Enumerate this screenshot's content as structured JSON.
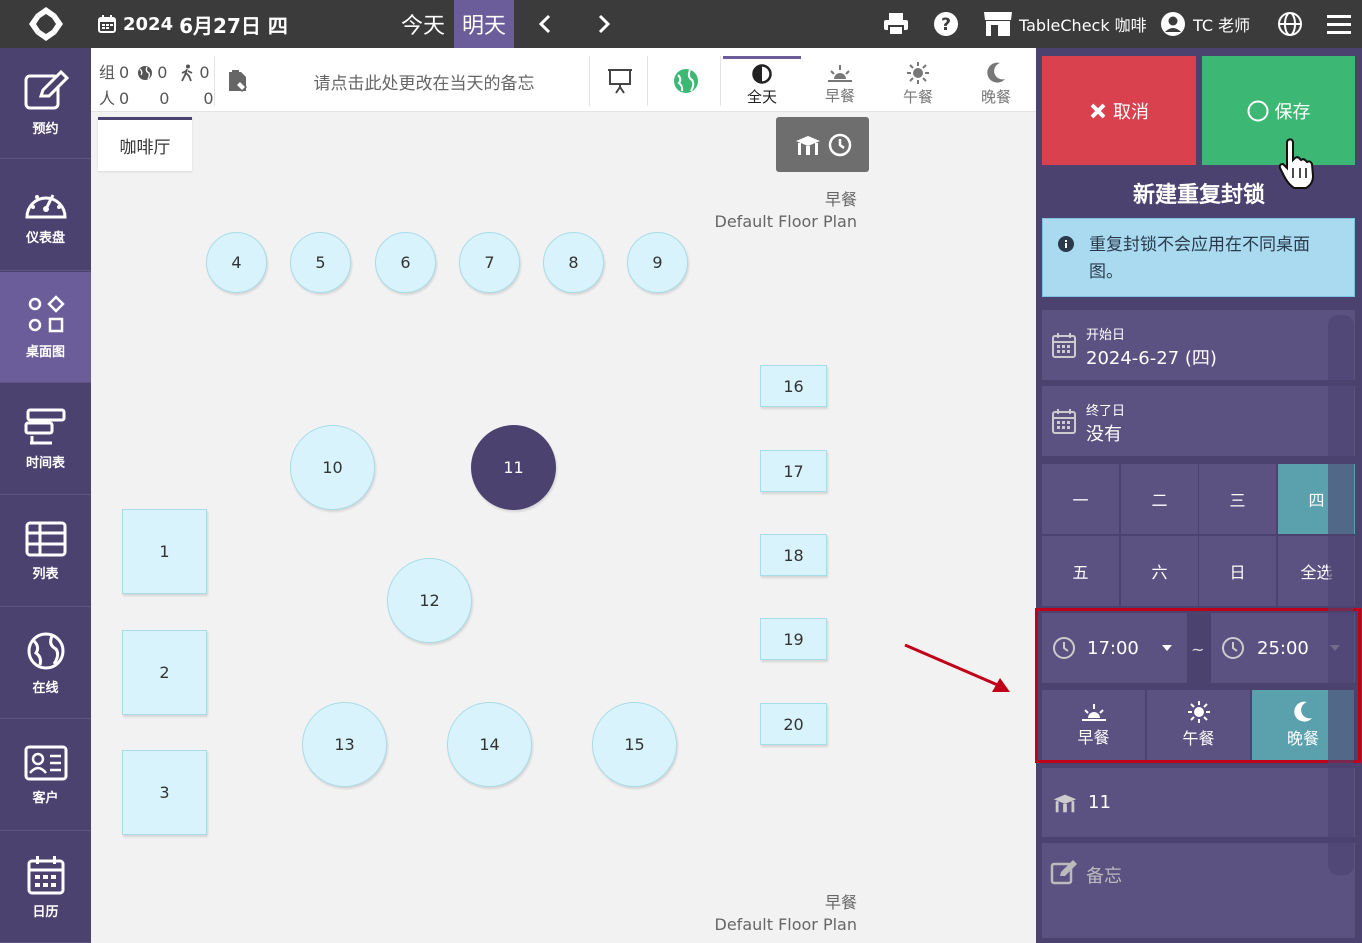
{
  "header": {
    "year": "2024",
    "date_label": "6月27日 四",
    "today_label": "今天",
    "tomorrow_label": "明天",
    "store_name": "TableCheck 咖啡",
    "user_name": "TC 老师"
  },
  "sidebar": {
    "items": [
      {
        "label": "预约",
        "icon": "edit-icon"
      },
      {
        "label": "仪表盘",
        "icon": "dashboard-icon"
      },
      {
        "label": "桌面图",
        "icon": "floorplan-icon"
      },
      {
        "label": "时间表",
        "icon": "timeline-icon"
      },
      {
        "label": "列表",
        "icon": "table-list-icon"
      },
      {
        "label": "在线",
        "icon": "globe-icon"
      },
      {
        "label": "客户",
        "icon": "customer-card-icon"
      },
      {
        "label": "日历",
        "icon": "calendar-icon"
      }
    ]
  },
  "subbar": {
    "stats": {
      "groups_label": "组",
      "groups_value": "0",
      "online_groups": "0",
      "walkin_groups": "0",
      "people_label": "人",
      "people_value": "0",
      "online_people": "0",
      "walkin_people": "0"
    },
    "memo_placeholder": "请点击此处更改在当天的备忘",
    "meal_tabs": [
      {
        "label": "全天",
        "icon": "half-circle-icon",
        "active": true
      },
      {
        "label": "早餐",
        "icon": "sunrise-icon",
        "active": false
      },
      {
        "label": "午餐",
        "icon": "sun-icon",
        "active": false
      },
      {
        "label": "晚餐",
        "icon": "moon-icon",
        "active": false
      }
    ]
  },
  "floor": {
    "tab_label": "咖啡厅",
    "plan_service": "早餐",
    "plan_name": "Default Floor Plan",
    "tables": [
      {
        "label": "4",
        "shape": "round"
      },
      {
        "label": "5",
        "shape": "round"
      },
      {
        "label": "6",
        "shape": "round"
      },
      {
        "label": "7",
        "shape": "round"
      },
      {
        "label": "8",
        "shape": "round"
      },
      {
        "label": "9",
        "shape": "round"
      },
      {
        "label": "16",
        "shape": "square"
      },
      {
        "label": "17",
        "shape": "square"
      },
      {
        "label": "18",
        "shape": "square"
      },
      {
        "label": "19",
        "shape": "square"
      },
      {
        "label": "20",
        "shape": "square"
      },
      {
        "label": "10",
        "shape": "round"
      },
      {
        "label": "11",
        "shape": "round",
        "selected": true
      },
      {
        "label": "12",
        "shape": "round"
      },
      {
        "label": "1",
        "shape": "square"
      },
      {
        "label": "2",
        "shape": "square"
      },
      {
        "label": "3",
        "shape": "square"
      },
      {
        "label": "13",
        "shape": "round"
      },
      {
        "label": "14",
        "shape": "round"
      },
      {
        "label": "15",
        "shape": "round"
      }
    ]
  },
  "panel": {
    "cancel_label": "取消",
    "save_label": "保存",
    "title": "新建重复封锁",
    "info": "重复封锁不会应用在不同桌面图。",
    "start_label": "开始日",
    "start_value": "2024-6-27 (四)",
    "end_label": "终了日",
    "end_value": "没有",
    "weekdays": [
      "一",
      "二",
      "三",
      "四",
      "五",
      "六",
      "日",
      "全选"
    ],
    "weekday_selected": "四",
    "time_from": "17:00",
    "time_sep": "~",
    "time_to": "25:00",
    "meals": [
      {
        "label": "早餐",
        "active": false
      },
      {
        "label": "午餐",
        "active": false
      },
      {
        "label": "晚餐",
        "active": true
      }
    ],
    "table_value": "11",
    "note_placeholder": "备忘"
  },
  "colors": {
    "primary": "#4b4270",
    "accent": "#6a5d9a",
    "cancel": "#d9414f",
    "save": "#3cb874",
    "selected_toggle": "#5aa0ad",
    "highlight": "#c00018"
  }
}
